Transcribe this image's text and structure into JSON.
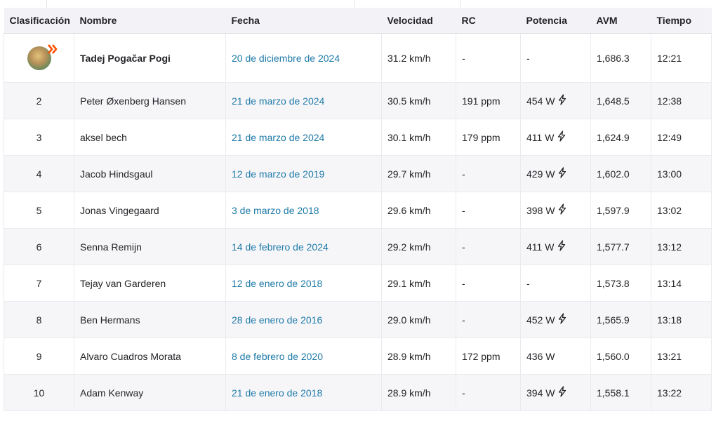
{
  "columns": [
    "Clasificación",
    "Nombre",
    "Fecha",
    "Velocidad",
    "RC",
    "Potencia",
    "AVM",
    "Tiempo"
  ],
  "rows": [
    {
      "rank": "",
      "name": "Tadej Pogačar Pogi",
      "date": "20 de diciembre de 2024",
      "speed": "31.2 km/h",
      "hr": "-",
      "power": "-",
      "power_icon": "",
      "avm": "1,686.3",
      "time": "12:21"
    },
    {
      "rank": "2",
      "name": "Peter Øxenberg Hansen",
      "date": "21 de marzo de 2024",
      "speed": "30.5 km/h",
      "hr": "191 ppm",
      "power": "454 W",
      "power_icon": "lightning-bolt-icon",
      "avm": "1,648.5",
      "time": "12:38"
    },
    {
      "rank": "3",
      "name": "aksel bech",
      "date": "21 de marzo de 2024",
      "speed": "30.1 km/h",
      "hr": "179 ppm",
      "power": "411 W",
      "power_icon": "lightning-bolt-icon",
      "avm": "1,624.9",
      "time": "12:49"
    },
    {
      "rank": "4",
      "name": "Jacob Hindsgaul",
      "date": "12 de marzo de 2019",
      "speed": "29.7 km/h",
      "hr": "-",
      "power": "429 W",
      "power_icon": "lightning-bolt-icon",
      "avm": "1,602.0",
      "time": "13:00"
    },
    {
      "rank": "5",
      "name": "Jonas Vingegaard",
      "date": "3 de marzo de 2018",
      "speed": "29.6 km/h",
      "hr": "-",
      "power": "398 W",
      "power_icon": "lightning-bolt-icon",
      "avm": "1,597.9",
      "time": "13:02"
    },
    {
      "rank": "6",
      "name": "Senna Remijn",
      "date": "14 de febrero de 2024",
      "speed": "29.2 km/h",
      "hr": "-",
      "power": "411 W",
      "power_icon": "lightning-bolt-icon",
      "avm": "1,577.7",
      "time": "13:12"
    },
    {
      "rank": "7",
      "name": "Tejay van Garderen",
      "date": "12 de enero de 2018",
      "speed": "29.1 km/h",
      "hr": "-",
      "power": "-",
      "power_icon": "",
      "avm": "1,573.8",
      "time": "13:14"
    },
    {
      "rank": "8",
      "name": "Ben Hermans",
      "date": "28 de enero de 2016",
      "speed": "29.0 km/h",
      "hr": "-",
      "power": "452 W",
      "power_icon": "lightning-bolt-icon",
      "avm": "1,565.9",
      "time": "13:18"
    },
    {
      "rank": "9",
      "name": "Alvaro Cuadros Morata",
      "date": "8 de febrero de 2020",
      "speed": "28.9 km/h",
      "hr": "172 ppm",
      "power": "436 W",
      "power_icon": "",
      "avm": "1,560.0",
      "time": "13:21"
    },
    {
      "rank": "10",
      "name": "Adam Kenway",
      "date": "21 de enero de 2018",
      "speed": "28.9 km/h",
      "hr": "-",
      "power": "394 W",
      "power_icon": "lightning-bolt-icon",
      "avm": "1,558.1",
      "time": "13:22"
    }
  ],
  "colors": {
    "date_link": "#1f7aa8",
    "header_bg": "#f3f3f7",
    "row_alt_bg": "#f6f6f9",
    "badge": "#fc5200"
  }
}
